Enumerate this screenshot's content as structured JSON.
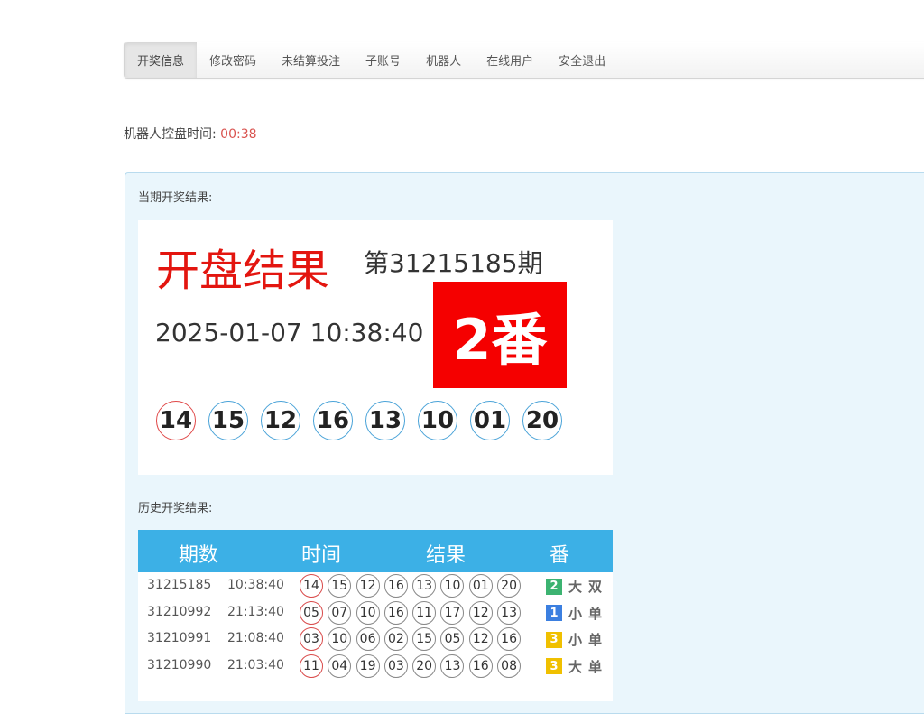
{
  "nav": {
    "items": [
      "开奖信息",
      "修改密码",
      "未结算投注",
      "子账号",
      "机器人",
      "在线用户",
      "安全退出"
    ]
  },
  "robot": {
    "label": "机器人控盘时间:",
    "time": "00:38"
  },
  "current": {
    "section_label": "当期开奖结果:",
    "title": "开盘结果",
    "issue": "第31215185期",
    "datetime": "2025-01-07 10:38:40",
    "fan": "2番",
    "balls": [
      "14",
      "15",
      "12",
      "16",
      "13",
      "10",
      "01",
      "20"
    ]
  },
  "history": {
    "section_label": "历史开奖结果:",
    "headers": {
      "issue": "期数",
      "time": "时间",
      "result": "结果",
      "fan": "番"
    },
    "rows": [
      {
        "issue": "31215185",
        "time": "10:38:40",
        "balls": [
          "14",
          "15",
          "12",
          "16",
          "13",
          "10",
          "01",
          "20"
        ],
        "fan": "2",
        "fan_color": "#3cb371",
        "size": "大",
        "parity": "双"
      },
      {
        "issue": "31210992",
        "time": "21:13:40",
        "balls": [
          "05",
          "07",
          "10",
          "16",
          "11",
          "17",
          "12",
          "13"
        ],
        "fan": "1",
        "fan_color": "#3b7fe0",
        "size": "小",
        "parity": "单"
      },
      {
        "issue": "31210991",
        "time": "21:08:40",
        "balls": [
          "03",
          "10",
          "06",
          "02",
          "15",
          "05",
          "12",
          "16"
        ],
        "fan": "3",
        "fan_color": "#f0c000",
        "size": "小",
        "parity": "单"
      },
      {
        "issue": "31210990",
        "time": "21:03:40",
        "balls": [
          "11",
          "04",
          "19",
          "03",
          "20",
          "13",
          "16",
          "08"
        ],
        "fan": "3",
        "fan_color": "#f0c000",
        "size": "大",
        "parity": "单"
      }
    ]
  }
}
